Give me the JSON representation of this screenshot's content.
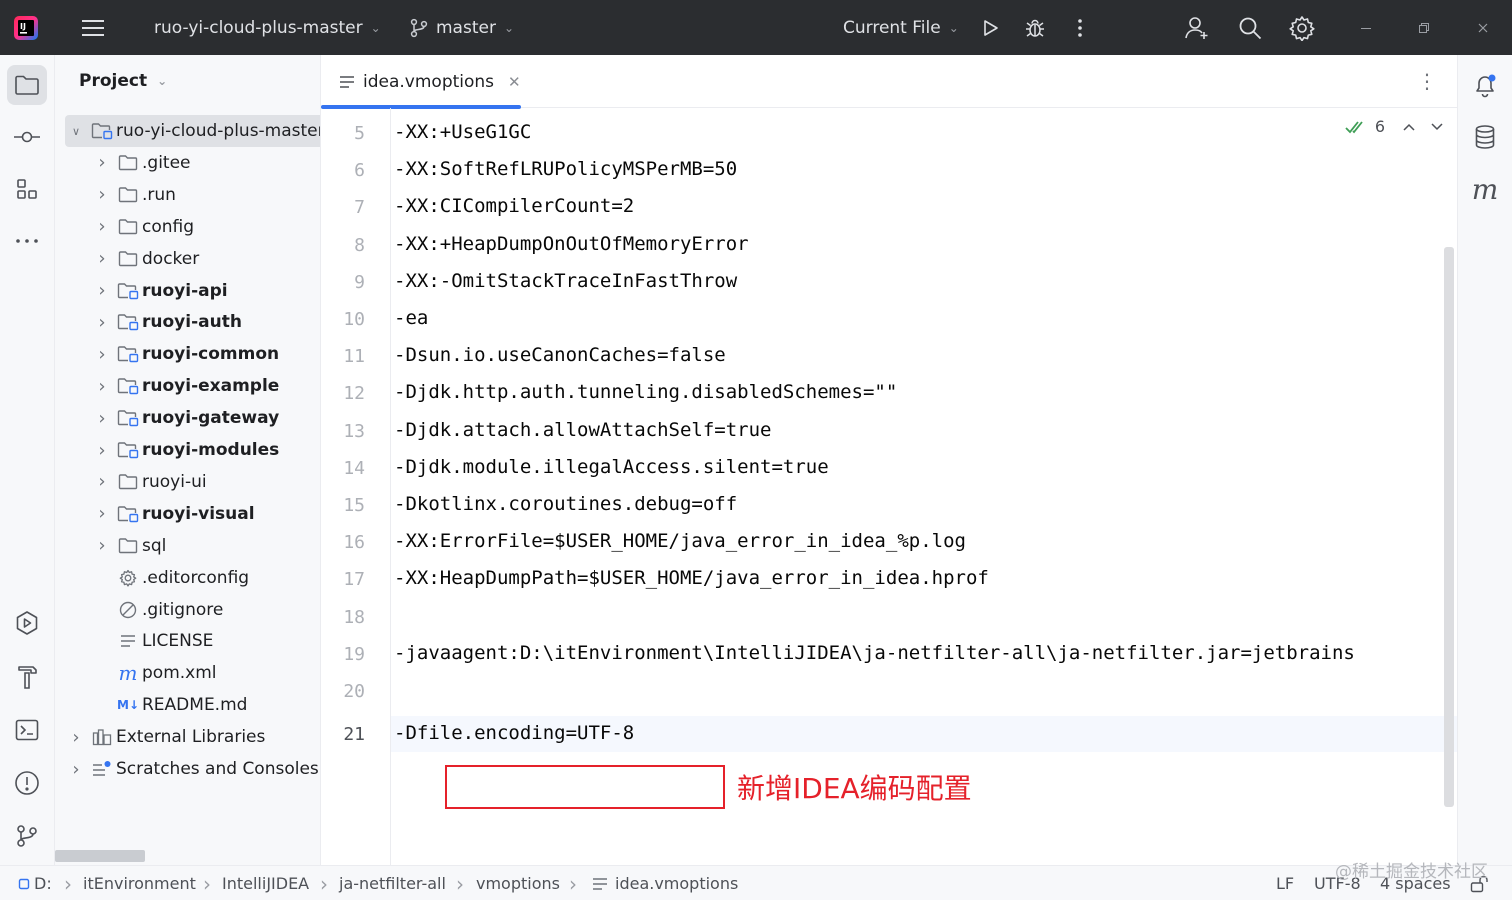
{
  "titlebar": {
    "project_name": "ruo-yi-cloud-plus-master",
    "branch": "master",
    "run_config": "Current File"
  },
  "project_panel": {
    "title": "Project",
    "tree": [
      {
        "label": "ruo-yi-cloud-plus-master",
        "suffix": "|",
        "icon": "module-folder-icon",
        "bold": false,
        "level": 0,
        "expanded": true
      },
      {
        "label": ".gitee",
        "icon": "folder-icon",
        "bold": false,
        "level": 1,
        "arrow": true
      },
      {
        "label": ".run",
        "icon": "folder-icon",
        "bold": false,
        "level": 1,
        "arrow": true
      },
      {
        "label": "config",
        "icon": "folder-icon",
        "bold": false,
        "level": 1,
        "arrow": true
      },
      {
        "label": "docker",
        "icon": "folder-icon",
        "bold": false,
        "level": 1,
        "arrow": true
      },
      {
        "label": "ruoyi-api",
        "icon": "module-folder-icon",
        "bold": true,
        "level": 1,
        "arrow": true
      },
      {
        "label": "ruoyi-auth",
        "icon": "module-folder-icon",
        "bold": true,
        "level": 1,
        "arrow": true
      },
      {
        "label": "ruoyi-common",
        "icon": "module-folder-icon",
        "bold": true,
        "level": 1,
        "arrow": true
      },
      {
        "label": "ruoyi-example",
        "icon": "module-folder-icon",
        "bold": true,
        "level": 1,
        "arrow": true
      },
      {
        "label": "ruoyi-gateway",
        "icon": "module-folder-icon",
        "bold": true,
        "level": 1,
        "arrow": true
      },
      {
        "label": "ruoyi-modules",
        "icon": "module-folder-icon",
        "bold": true,
        "level": 1,
        "arrow": true
      },
      {
        "label": "ruoyi-ui",
        "icon": "folder-icon",
        "bold": false,
        "level": 1,
        "arrow": true
      },
      {
        "label": "ruoyi-visual",
        "icon": "module-folder-icon",
        "bold": true,
        "level": 1,
        "arrow": true
      },
      {
        "label": "sql",
        "icon": "folder-icon",
        "bold": false,
        "level": 1,
        "arrow": true
      },
      {
        "label": ".editorconfig",
        "icon": "gear-icon",
        "bold": false,
        "level": 1,
        "arrow": false
      },
      {
        "label": ".gitignore",
        "icon": "ignore-file-icon",
        "bold": false,
        "level": 1,
        "arrow": false
      },
      {
        "label": "LICENSE",
        "icon": "text-file-icon",
        "bold": false,
        "level": 1,
        "arrow": false
      },
      {
        "label": "pom.xml",
        "icon": "maven-icon",
        "bold": false,
        "level": 1,
        "arrow": false
      },
      {
        "label": "README.md",
        "icon": "markdown-icon",
        "bold": false,
        "level": 1,
        "arrow": false
      },
      {
        "label": "External Libraries",
        "icon": "libraries-icon",
        "bold": false,
        "level": 0,
        "arrow": true
      },
      {
        "label": "Scratches and Consoles",
        "icon": "scratches-icon",
        "bold": false,
        "level": 0,
        "arrow": true
      }
    ]
  },
  "editor": {
    "tab_label": "idea.vmoptions",
    "inspection_count": "6",
    "lines": [
      {
        "num": "5",
        "text": "-XX:+UseG1GC"
      },
      {
        "num": "6",
        "text": "-XX:SoftRefLRUPolicyMSPerMB=50"
      },
      {
        "num": "7",
        "text": "-XX:CICompilerCount=2"
      },
      {
        "num": "8",
        "text": "-XX:+HeapDumpOnOutOfMemoryError"
      },
      {
        "num": "9",
        "text": "-XX:-OmitStackTraceInFastThrow"
      },
      {
        "num": "10",
        "text": "-ea"
      },
      {
        "num": "11",
        "text": "-Dsun.io.useCanonCaches=false"
      },
      {
        "num": "12",
        "text": "-Djdk.http.auth.tunneling.disabledSchemes=\"\""
      },
      {
        "num": "13",
        "text": "-Djdk.attach.allowAttachSelf=true"
      },
      {
        "num": "14",
        "text": "-Djdk.module.illegalAccess.silent=true"
      },
      {
        "num": "15",
        "text": "-Dkotlinx.coroutines.debug=off"
      },
      {
        "num": "16",
        "text": "-XX:ErrorFile=$USER_HOME/java_error_in_idea_%p.log"
      },
      {
        "num": "17",
        "text": "-XX:HeapDumpPath=$USER_HOME/java_error_in_idea.hprof"
      },
      {
        "num": "18",
        "text": ""
      },
      {
        "num": "19",
        "text": "-javaagent:D:\\itEnvironment\\IntelliJIDEA\\ja-netfilter-all\\ja-netfilter.jar=jetbrains"
      },
      {
        "num": "20",
        "text": ""
      },
      {
        "num": "21",
        "text": "-Dfile.encoding=UTF-8"
      }
    ],
    "annotation": "新增IDEA编码配置"
  },
  "status_bar": {
    "breadcrumbs": [
      "D:",
      "itEnvironment",
      "IntelliJIDEA",
      "ja-netfilter-all",
      "vmoptions",
      "idea.vmoptions"
    ],
    "line_separator": "LF",
    "encoding": "UTF-8",
    "indent": "4 spaces",
    "watermark": "@稀土掘金技术社区"
  },
  "colors": {
    "titlebar_bg": "#2b2d30",
    "accent": "#3574f0",
    "annotation_red": "#e5212a"
  }
}
